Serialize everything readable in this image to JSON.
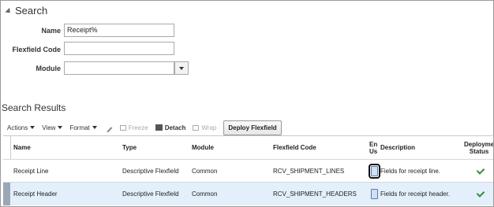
{
  "search": {
    "title": "Search",
    "fields": {
      "name": {
        "label": "Name",
        "value": "Receipt%"
      },
      "flexfield_code": {
        "label": "Flexfield Code",
        "value": ""
      },
      "module": {
        "label": "Module",
        "value": ""
      }
    }
  },
  "results": {
    "title": "Search Results",
    "toolbar": {
      "actions": "Actions",
      "view": "View",
      "format": "Format",
      "freeze": "Freeze",
      "detach": "Detach",
      "wrap": "Wrap",
      "deploy": "Deploy Flexfield"
    },
    "columns": [
      "Name",
      "Type",
      "Module",
      "Flexfield Code",
      "En Us",
      "Description",
      "Deployme Status"
    ],
    "rows": [
      {
        "name": "Receipt Line",
        "type": "Descriptive Flexfield",
        "module": "Common",
        "code": "RCV_SHIPMENT_LINES",
        "description": "Fields for receipt line.",
        "selected": false
      },
      {
        "name": "Receipt Header",
        "type": "Descriptive Flexfield",
        "module": "Common",
        "code": "RCV_SHIPMENT_HEADERS",
        "description": "Fields for receipt header.",
        "selected": true
      }
    ]
  },
  "colors": {
    "selected_row": "#e3f0fb",
    "deployed_check": "#3a8a3a"
  },
  "icons": {
    "enabled_usage": "document-icon",
    "status": "checkmark-icon"
  }
}
